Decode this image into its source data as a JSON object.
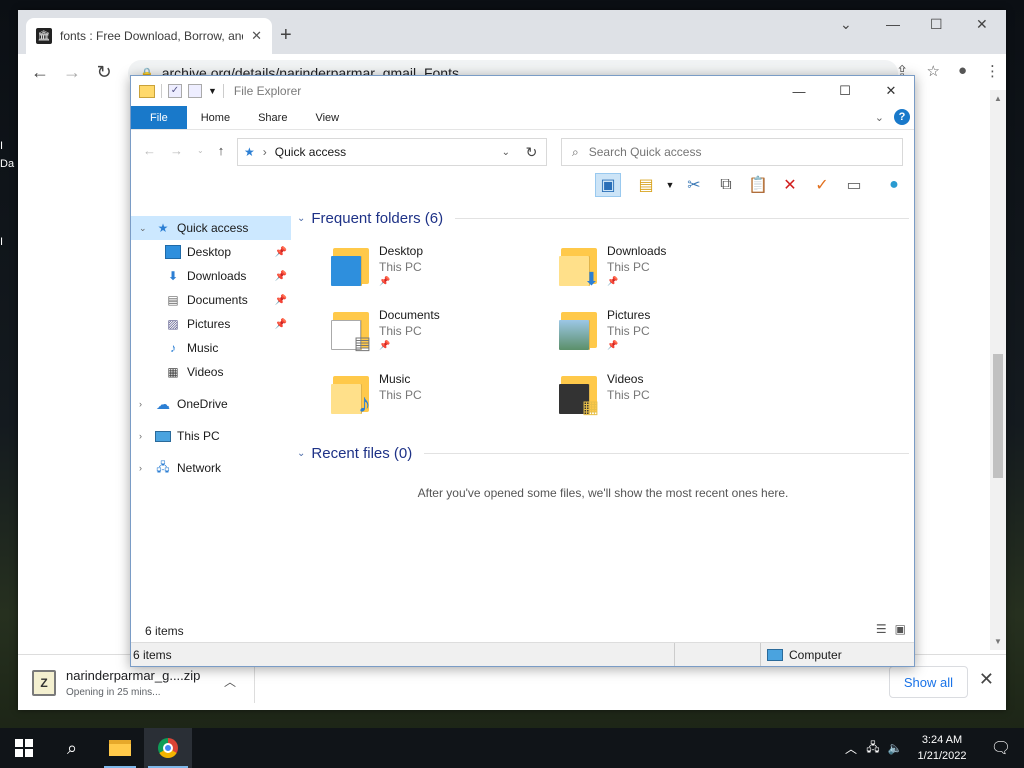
{
  "desktop": {
    "frag1": "I",
    "frag2": "Da",
    "frag3": "I"
  },
  "browser": {
    "tab_title": "fonts : Free Download, Borrow, and Streaming : Internet Archive",
    "url": "archive.org/details/narinderparmar_gmail_Fonts",
    "download": {
      "filename": "narinderparmar_g....zip",
      "status": "Opening in 25 mins...",
      "show_all": "Show all"
    }
  },
  "explorer": {
    "title": "File Explorer",
    "ribbon_tabs": [
      "File",
      "Home",
      "Share",
      "View"
    ],
    "path": "Quick access",
    "search_placeholder": "Search Quick access",
    "nav": {
      "quick_access": "Quick access",
      "pinned": [
        "Desktop",
        "Downloads",
        "Documents",
        "Pictures"
      ],
      "unpinned": [
        "Music",
        "Videos"
      ],
      "onedrive": "OneDrive",
      "this_pc": "This PC",
      "network": "Network"
    },
    "frequent_header": "Frequent folders (6)",
    "folders": [
      {
        "name": "Desktop",
        "location": "This PC"
      },
      {
        "name": "Downloads",
        "location": "This PC"
      },
      {
        "name": "Documents",
        "location": "This PC"
      },
      {
        "name": "Pictures",
        "location": "This PC"
      },
      {
        "name": "Music",
        "location": "This PC"
      },
      {
        "name": "Videos",
        "location": "This PC"
      }
    ],
    "recent_header": "Recent files (0)",
    "recent_empty": "After you've opened some files, we'll show the most recent ones here.",
    "item_count": "6 items",
    "status_items": "6 items",
    "status_computer": "Computer"
  },
  "taskbar": {
    "time": "3:24 AM",
    "date": "1/21/2022"
  },
  "colors": {
    "accent": "#1979ca",
    "selection": "#cce8ff",
    "folder": "#ffc94a"
  }
}
